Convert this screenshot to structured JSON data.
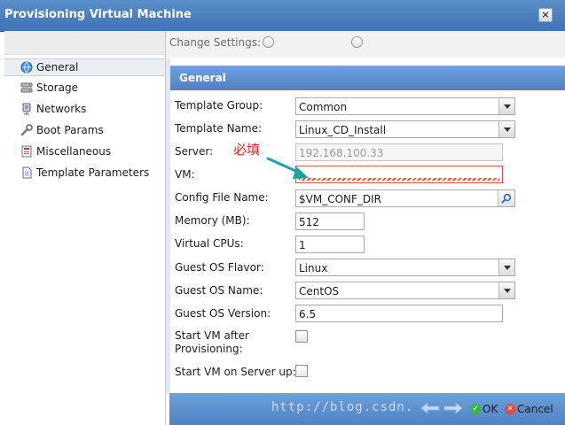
{
  "window": {
    "title": "Provisioning Virtual Machine",
    "close_label": "×"
  },
  "sidebar": {
    "items": [
      {
        "label": "General",
        "icon": "globe-icon",
        "active": true
      },
      {
        "label": "Storage",
        "icon": "storage-icon",
        "active": false
      },
      {
        "label": "Networks",
        "icon": "network-icon",
        "active": false
      },
      {
        "label": "Boot Params",
        "icon": "wrench-icon",
        "active": false
      },
      {
        "label": "Miscellaneous",
        "icon": "misc-icon",
        "active": false
      },
      {
        "label": "Template Parameters",
        "icon": "document-icon",
        "active": false
      }
    ]
  },
  "change_settings": {
    "label": "Change Settings:"
  },
  "section": {
    "title": "General"
  },
  "form": {
    "template_group": {
      "label": "Template Group:",
      "value": "Common"
    },
    "template_name": {
      "label": "Template Name:",
      "value": "Linux_CD_Install"
    },
    "server": {
      "label": "Server:",
      "value": "192.168.100.33"
    },
    "vm": {
      "label": "VM:",
      "value": ""
    },
    "config_file": {
      "label": "Config File Name:",
      "value": "$VM_CONF_DIR"
    },
    "memory": {
      "label": "Memory (MB):",
      "value": "512"
    },
    "vcpus": {
      "label": "Virtual CPUs:",
      "value": "1"
    },
    "os_flavor": {
      "label": "Guest OS Flavor:",
      "value": "Linux"
    },
    "os_name": {
      "label": "Guest OS Name:",
      "value": "CentOS"
    },
    "os_version": {
      "label": "Guest OS Version:",
      "value": "6.5"
    },
    "start_after": {
      "label": "Start VM after Provisioning:"
    },
    "start_server": {
      "label": "Start VM on Server up:"
    }
  },
  "annotation": {
    "text": "必填",
    "color": "#e22a2a",
    "arrow_color": "#1aa3a3"
  },
  "footer": {
    "ok_label": "OK",
    "cancel_label": "Cancel"
  },
  "watermark": {
    "text": "http://blog.csdn."
  },
  "colors": {
    "accent": "#4e82c4",
    "invalid": "#d6514d"
  }
}
